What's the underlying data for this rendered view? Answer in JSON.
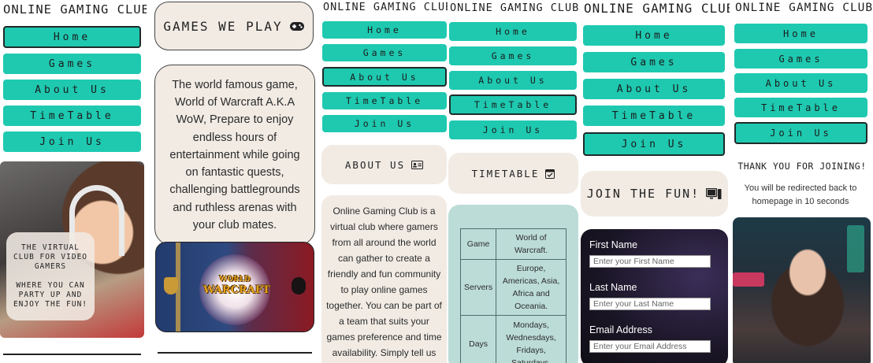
{
  "site_title": "ONLINE GAMING CLUB",
  "nav": {
    "home": "Home",
    "games": "Games",
    "about": "About Us",
    "timetable": "TimeTable",
    "join": "Join Us"
  },
  "col1": {
    "active_nav": "home",
    "overlay_line1": "THE VIRTUAL CLUB FOR VIDEO GAMERS",
    "overlay_line2": "WHERE YOU CAN PARTY UP AND ENJOY THE FUN!",
    "photo_icon": "gamer-girl-headphones-photo"
  },
  "col2": {
    "section_title": "GAMES WE PLAY",
    "section_icon": "gamepad-icon",
    "paragraph": "The world famous game, World of Warcraft A.K.A WoW, Prepare to enjoy endless hours of entertainment while going on fantastic quests, challenging battlegrounds and ruthless arenas with your club mates.",
    "banner_logo_line1": "WORLD",
    "banner_logo_line2": "WARCRAFT"
  },
  "col3": {
    "active_nav": "about",
    "section_title": "ABOUT US",
    "section_icon": "id-card-icon",
    "paragraph": "Online Gaming Club is a virtual club where gamers from all around the world can gather to create a friendly and fun community to play online games together. You can be part of a team that suits your games preference and time availability. Simply tell us"
  },
  "col4": {
    "active_nav": "timetable",
    "section_title": "TIMETABLE",
    "section_icon": "calendar-icon",
    "table": [
      {
        "label": "Game",
        "value": "World of Warcraft."
      },
      {
        "label": "Servers",
        "value": "Europe, Americas, Asia, Africa and Oceania."
      },
      {
        "label": "Days",
        "value": "Mondays, Wednesdays, Fridays, Saturdays."
      }
    ]
  },
  "col5": {
    "active_nav": "join",
    "section_title": "JOIN THE FUN!",
    "section_icon": "computer-icon",
    "form": {
      "first_name_label": "First Name",
      "first_name_placeholder": "Enter your First Name",
      "last_name_label": "Last Name",
      "last_name_placeholder": "Enter your Last Name",
      "email_label": "Email Address",
      "email_placeholder": "Enter your Email Address"
    }
  },
  "col6": {
    "active_nav": "join",
    "thank_you": "THANK YOU FOR JOINING!",
    "redirect_text": "You will be redirected back to homepage in 10 seconds",
    "photo_icon": "gamer-girl-neon-photo"
  },
  "colors": {
    "nav_button": "#1ec9b0",
    "card_beige": "#f1ebe4",
    "table_bg": "#bcdcd8"
  }
}
